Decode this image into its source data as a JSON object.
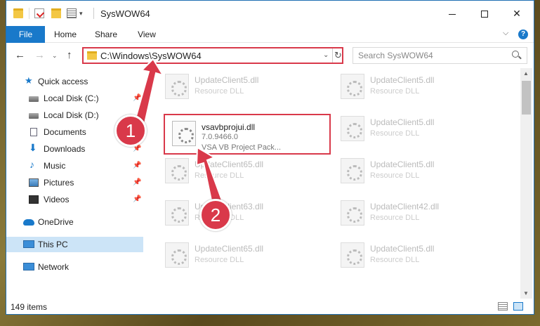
{
  "window": {
    "title": "SysWOW64",
    "minimize_icon": "minimize-icon",
    "maximize_icon": "maximize-icon",
    "close_glyph": "✕"
  },
  "ribbon": {
    "tabs": [
      "File",
      "Home",
      "Share",
      "View"
    ],
    "expand_glyph": "⌵",
    "help_glyph": "?"
  },
  "nav": {
    "back_glyph": "←",
    "forward_glyph": "→",
    "recent_glyph": "⌄",
    "up_glyph": "↑",
    "address": "C:\\Windows\\SysWOW64",
    "address_drop_glyph": "⌄",
    "refresh_glyph": "↻",
    "search_placeholder": "Search SysWOW64"
  },
  "sidebar": {
    "items": [
      {
        "label": "Quick access",
        "icon": "star-icon"
      },
      {
        "label": "Local Disk (C:)",
        "icon": "disk-icon",
        "pinned": true
      },
      {
        "label": "Local Disk (D:)",
        "icon": "disk-icon"
      },
      {
        "label": "Documents",
        "icon": "document-icon",
        "pinned": true
      },
      {
        "label": "Downloads",
        "icon": "download-icon",
        "pinned": true
      },
      {
        "label": "Music",
        "icon": "music-icon",
        "pinned": true
      },
      {
        "label": "Pictures",
        "icon": "pictures-icon",
        "pinned": true
      },
      {
        "label": "Videos",
        "icon": "videos-icon",
        "pinned": true
      },
      {
        "label": "OneDrive",
        "icon": "cloud-icon"
      },
      {
        "label": "This PC",
        "icon": "computer-icon",
        "selected": true
      },
      {
        "label": "Network",
        "icon": "network-icon"
      }
    ],
    "pin_glyph": "📌"
  },
  "files": [
    {
      "name": "UpdateClient5.dll",
      "type": "Resource DLL"
    },
    {
      "name": "UpdateClient5.dll",
      "type": "Resource DLL"
    },
    {
      "name": "vsavbprojui.dll",
      "type": "7.0.9466.0",
      "desc": "VSA VB Project Pack...",
      "highlighted": true
    },
    {
      "name": "UpdateClient5.dll",
      "type": "Resource DLL"
    },
    {
      "name": "UpdateClient65.dll",
      "type": "Resource DLL"
    },
    {
      "name": "UpdateClient5.dll",
      "type": "Resource DLL"
    },
    {
      "name": "UpdateClient63.dll",
      "type": "Resource DLL"
    },
    {
      "name": "UpdateClient42.dll",
      "type": "Resource DLL"
    },
    {
      "name": "UpdateClient65.dll",
      "type": "Resource DLL"
    },
    {
      "name": "UpdateClient5.dll",
      "type": "Resource DLL"
    }
  ],
  "status": {
    "item_count": "149 items"
  },
  "annotations": {
    "step1": "1",
    "step2": "2",
    "color": "#d9394a"
  },
  "scroll": {
    "up_glyph": "▲",
    "down_glyph": "▼"
  }
}
